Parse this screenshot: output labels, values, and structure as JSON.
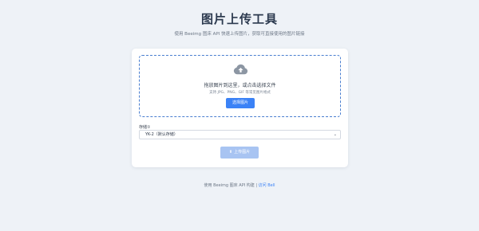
{
  "header": {
    "title": "图片上传工具",
    "subtitle": "使用 Beeimg 图床 API 快速上传图片，获取可直接使用的图片链接"
  },
  "dropzone": {
    "icon": "cloud-upload-icon",
    "text": "拖放图片到这里，或点击选择文件",
    "hint": "支持 JPG、PNG、GIF 等常见图片格式",
    "select_button": "选择图片"
  },
  "storage": {
    "label": "存储①",
    "selected": "YK-2（默认存储）"
  },
  "upload": {
    "icon": "upload-icon",
    "label": "上传图片"
  },
  "footer": {
    "text": "使用 Beeimg 图床 API 构建 | ",
    "link": "访问 Bell"
  },
  "colors": {
    "accent": "#3b82f6",
    "disabled_button": "#a8c4f2",
    "background": "#eef2f7",
    "dropzone_border": "#4a7fd0"
  }
}
